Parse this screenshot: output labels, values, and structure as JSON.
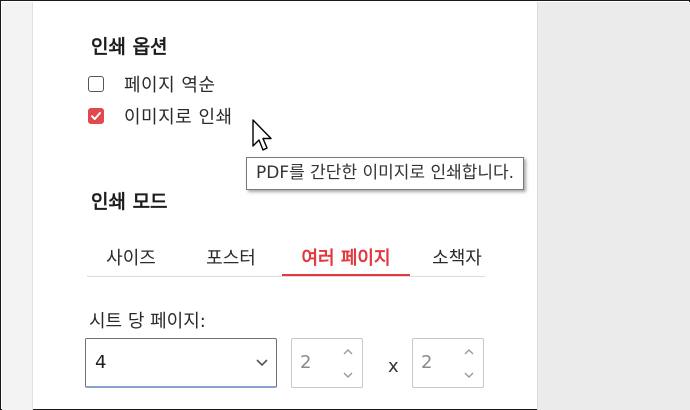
{
  "print_options": {
    "title": "인쇄 옵션",
    "options": [
      {
        "label": "페이지 역순",
        "checked": false
      },
      {
        "label": "이미지로 인쇄",
        "checked": true
      }
    ],
    "tooltip": "PDF를 간단한 이미지로 인쇄합니다."
  },
  "print_mode": {
    "title": "인쇄 모드",
    "tabs": [
      {
        "label": "사이즈",
        "active": false
      },
      {
        "label": "포스터",
        "active": false
      },
      {
        "label": "여러 페이지",
        "active": true
      },
      {
        "label": "소책자",
        "active": false
      }
    ]
  },
  "pages_per_sheet": {
    "label": "시트 당 페이지:",
    "selected": "4",
    "cols": "2",
    "times": "x",
    "rows": "2"
  },
  "colors": {
    "accent": "#e2393f",
    "checkbox": "#e2484f"
  }
}
